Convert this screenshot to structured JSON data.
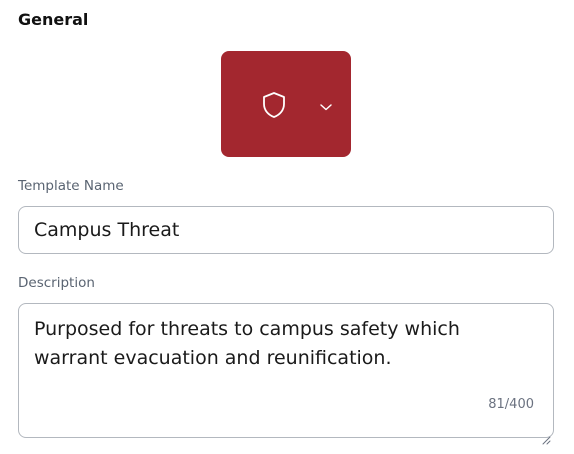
{
  "section": {
    "title": "General"
  },
  "icon_picker": {
    "icon": "shield-icon",
    "dropdown_icon": "chevron-down-icon",
    "background_color": "#a3272f"
  },
  "template_name": {
    "label": "Template Name",
    "value": "Campus Threat"
  },
  "description": {
    "label": "Description",
    "value": "Purposed for threats to campus safety which warrant evacuation and reunification.",
    "counter": "81/400"
  }
}
